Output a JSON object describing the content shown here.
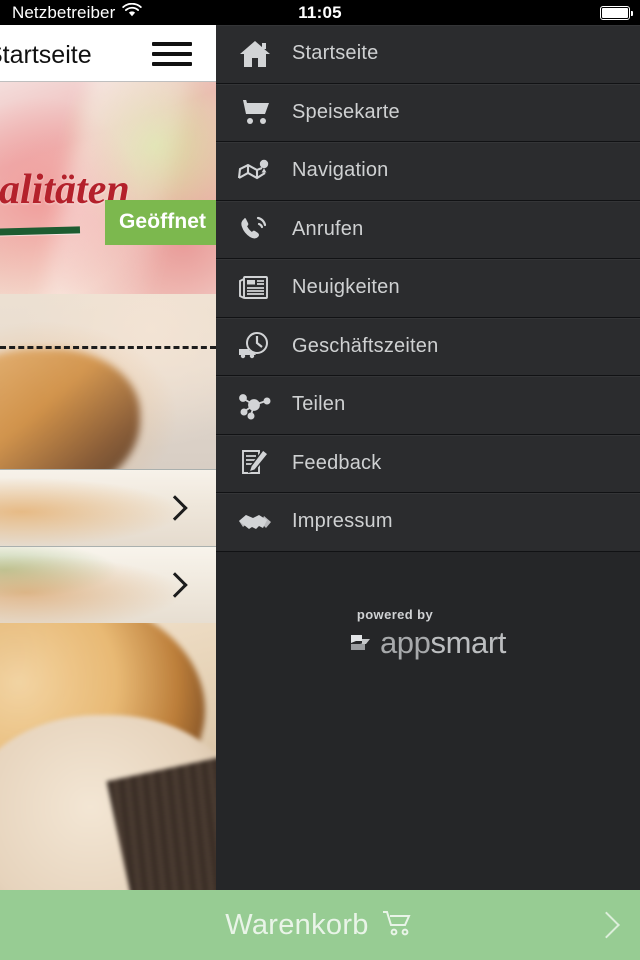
{
  "status_bar": {
    "carrier": "Netzbetreiber",
    "wifi_icon": "wifi-icon",
    "time": "11:05",
    "battery_icon": "battery-full-icon"
  },
  "app_behind": {
    "title_fragment": "Startseite",
    "menu_icon": "hamburger-icon",
    "hero": {
      "title_fragment": "Spezialitäten",
      "open_badge": "Geöffnet"
    },
    "rows": [
      {
        "chevron_icon": "chevron-right-icon"
      },
      {
        "chevron_icon": "chevron-right-icon"
      }
    ]
  },
  "drawer": {
    "items": [
      {
        "label": "Startseite",
        "icon": "home-icon"
      },
      {
        "label": "Speisekarte",
        "icon": "shopping-cart-icon"
      },
      {
        "label": "Navigation",
        "icon": "map-pin-icon"
      },
      {
        "label": "Anrufen",
        "icon": "phone-icon"
      },
      {
        "label": "Neuigkeiten",
        "icon": "newspaper-icon"
      },
      {
        "label": "Geschäftszeiten",
        "icon": "clock-truck-icon"
      },
      {
        "label": "Teilen",
        "icon": "share-network-icon"
      },
      {
        "label": "Feedback",
        "icon": "document-pencil-icon"
      },
      {
        "label": "Impressum",
        "icon": "handshake-icon"
      }
    ],
    "footer": {
      "powered_by": "powered by",
      "brand_first": "app",
      "brand_second": "smart",
      "logo_icon": "appsmart-logo-icon"
    }
  },
  "cart_bar": {
    "label": "Warenkorb",
    "cart_icon": "shopping-cart-icon",
    "chevron_icon": "chevron-right-icon"
  },
  "colors": {
    "drawer_bg": "#252628",
    "drawer_item_bg": "#2b2c2e",
    "drawer_divider": "#111214",
    "menu_text": "#cfd1d2",
    "cart_bar_bg": "#97cc93",
    "cart_text": "#e9f4e8",
    "open_badge_bg": "#7cb84e",
    "hero_title": "#b4212b",
    "status_bar_bg": "#000000"
  }
}
